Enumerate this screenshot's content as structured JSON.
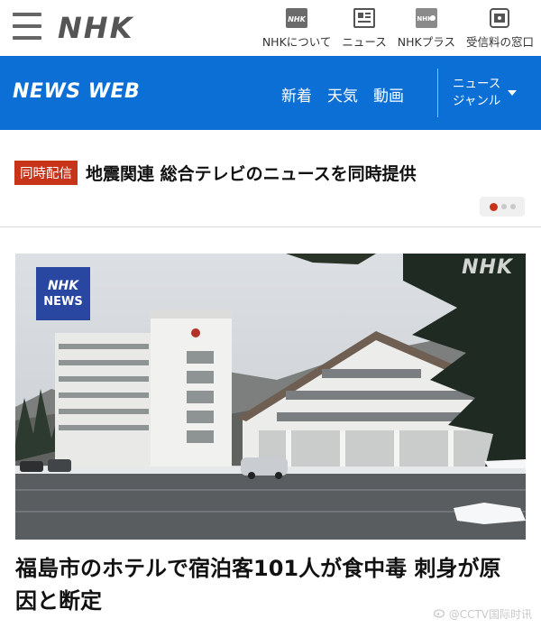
{
  "header": {
    "logo": "NHK",
    "nav": [
      {
        "label": "NHKについて",
        "icon": "nhk-box-icon"
      },
      {
        "label": "ニュース",
        "icon": "newspaper-icon"
      },
      {
        "label": "NHKプラス",
        "icon": "nhk-plus-icon"
      },
      {
        "label": "受信料の窓口",
        "icon": "receipt-window-icon"
      }
    ]
  },
  "newsbar": {
    "logo": "NEWS WEB",
    "links": [
      "新着",
      "天気",
      "動画"
    ],
    "genre_line1": "ニュース",
    "genre_line2": "ジャンル",
    "bg_color": "#0b6fd6"
  },
  "live": {
    "badge": "同時配信",
    "title": "地震関連 総合テレビのニュースを同時提供",
    "badge_color": "#c8341a",
    "pager": {
      "current": 1,
      "total": 3
    }
  },
  "article": {
    "image_badge_line1": "NHK",
    "image_badge_line2": "NEWS",
    "image_watermark": "NHK",
    "headline": "福島市のホテルで宿泊客101人が食中毒 刺身が原因と断定"
  },
  "overlay": {
    "watermark": "@CCTV国际时讯"
  }
}
